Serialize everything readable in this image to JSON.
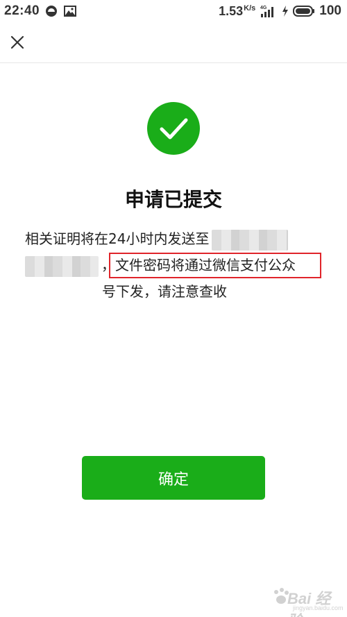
{
  "status_bar": {
    "time": "22:40",
    "net_speed": "1.53",
    "net_speed_unit": "K/s",
    "network_type": "4G",
    "battery_percent": "100",
    "icons": [
      "app-notification-icon",
      "image-icon",
      "signal-icon",
      "charging-icon",
      "battery-icon"
    ]
  },
  "nav": {
    "close_icon": "close-icon"
  },
  "result": {
    "icon": "checkmark-icon",
    "icon_color": "#1aad19",
    "title": "申请已提交",
    "message_line1": "相关证明将在24小时内发送至",
    "message_line2_prefix": "，",
    "message_line2_highlight": "文件密码将通过微信支付公众",
    "message_line3": "号下发，请注意查收",
    "highlight_color": "#e0242a"
  },
  "actions": {
    "confirm_label": "确定",
    "confirm_color": "#1aad19"
  },
  "watermark": {
    "brand": "Bai 经验",
    "url": "jingyan.baidu.com"
  }
}
